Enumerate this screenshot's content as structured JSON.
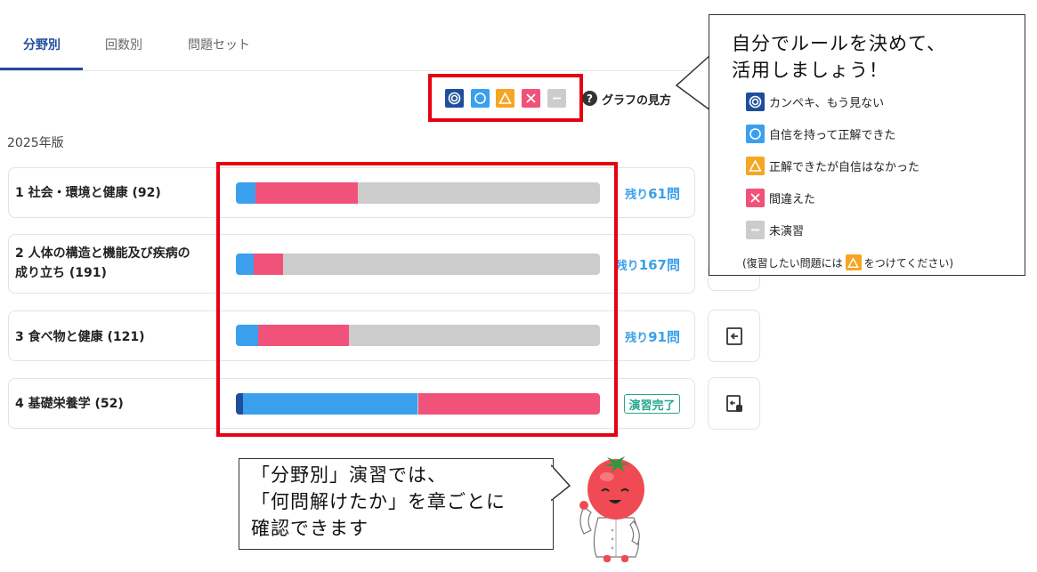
{
  "tabs": [
    {
      "label": "分野別",
      "active": true
    },
    {
      "label": "回数別",
      "active": false
    },
    {
      "label": "問題セット",
      "active": false
    }
  ],
  "legend_help_label": "グラフの見方",
  "legend_help_icon": "?",
  "edition": "2025年版",
  "colors": {
    "perfect": "#1f4e9c",
    "confident": "#3aa0ee",
    "unsure": "#f5a623",
    "wrong": "#f0527a",
    "unstudied": "#cccccc",
    "accent": "#1f4e9c",
    "annotation": "#e60012"
  },
  "chapters": [
    {
      "title_lines": [
        "1 社会・環境と健康 (92)"
      ],
      "progress": {
        "perfect": 0,
        "confident": 0.055,
        "wrong": 0.28
      },
      "remain_prefix": "残り",
      "remain_num": "61問"
    },
    {
      "title_lines": [
        "2 人体の構造と機能及び疾病の",
        "成り立ち (191)"
      ],
      "progress": {
        "perfect": 0,
        "confident": 0.05,
        "wrong": 0.08
      },
      "remain_prefix": "残り",
      "remain_num": "167問"
    },
    {
      "title_lines": [
        "3 食べ物と健康 (121)"
      ],
      "progress": {
        "perfect": 0,
        "confident": 0.06,
        "wrong": 0.25
      },
      "remain_prefix": "残り",
      "remain_num": "91問"
    },
    {
      "title_lines": [
        "4 基礎栄養学 (52)"
      ],
      "progress": {
        "perfect": 0.02,
        "confident": 0.48,
        "wrong": 0.5
      },
      "status": "演習完了"
    }
  ],
  "callout_right": {
    "lines": [
      "自分でルールを決めて、",
      "活用しましょう！"
    ],
    "legend": [
      {
        "icon": "double-circle-icon",
        "label": "カンペキ、もう見ない"
      },
      {
        "icon": "circle-icon",
        "label": "自信を持って正解できた"
      },
      {
        "icon": "triangle-icon",
        "label": "正解できたが自信はなかった"
      },
      {
        "icon": "cross-icon",
        "label": "間違えた"
      },
      {
        "icon": "dash-icon",
        "label": "未演習"
      }
    ],
    "note_before": "(復習したい問題には",
    "note_after": "をつけてください)"
  },
  "callout_bottom": {
    "lines": [
      "「分野別」演習では、",
      "「何問解けたか」を章ごとに",
      "確認できます"
    ]
  }
}
